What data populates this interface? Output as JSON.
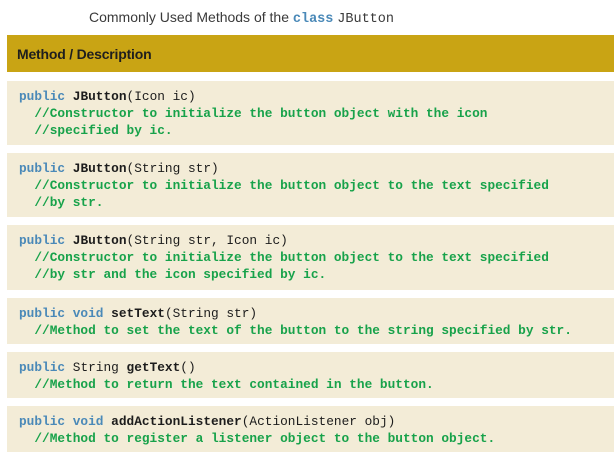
{
  "caption": {
    "prefix": "Commonly Used Methods of the",
    "keyword": "class",
    "class_name": "JButton"
  },
  "table": {
    "header": "Method / Description",
    "rows": [
      {
        "modifiers": "public",
        "name": "JButton",
        "params": "(Icon ic)",
        "comment": [
          "//Constructor to initialize the button object with the icon",
          "//specified by ic."
        ]
      },
      {
        "modifiers": "public",
        "name": "JButton",
        "params": "(String str)",
        "comment": [
          "//Constructor to initialize the button object to the text specified",
          "//by str."
        ]
      },
      {
        "modifiers": "public",
        "name": "JButton",
        "params": "(String str, Icon ic)",
        "comment": [
          "//Constructor to initialize the button object to the text specified",
          "//by str and the icon specified by ic."
        ]
      },
      {
        "modifiers": "public void",
        "name": "setText",
        "params": "(String str)",
        "comment": [
          "//Method to set the text of the button to the string specified by str."
        ]
      },
      {
        "modifiers": "public",
        "return_type": "String",
        "name": "getText",
        "params": "()",
        "comment": [
          "//Method to return the text contained in the button."
        ]
      },
      {
        "modifiers": "public void",
        "name": "addActionListener",
        "params": "(ActionListener obj)",
        "comment": [
          "//Method to register a listener object to the button object."
        ]
      }
    ]
  },
  "colors": {
    "header_bg": "#c9a414",
    "row_bg": "#f3ecd7",
    "keyword": "#4a89b8",
    "comment": "#17a24a"
  }
}
